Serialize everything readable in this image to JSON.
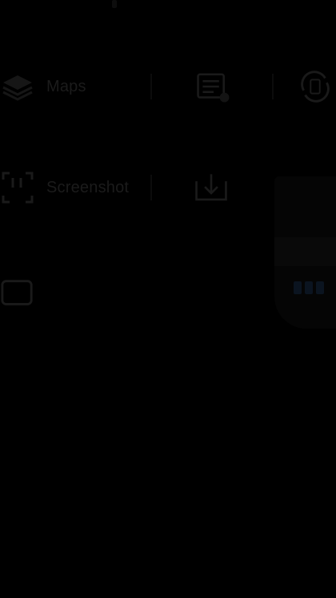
{
  "tiles": {
    "maps": {
      "label": "Maps",
      "icon": "layers-icon"
    },
    "task_settings": {
      "icon": "list-settings-icon"
    },
    "rotate": {
      "icon": "rotate-icon"
    },
    "screenshot": {
      "label": "Screenshot",
      "icon": "screenshot-icon"
    },
    "download": {
      "icon": "download-icon"
    },
    "cast": {
      "icon": "cast-icon"
    }
  },
  "colors": {
    "background": "#000000",
    "tile_text": "#1b1b1b",
    "icon_stroke": "#1a1a1a"
  }
}
